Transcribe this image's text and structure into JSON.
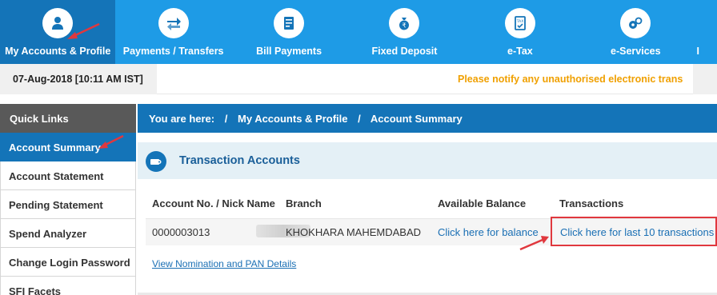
{
  "nav": {
    "items": [
      {
        "label": "My Accounts & Profile",
        "icon": "user-icon"
      },
      {
        "label": "Payments / Transfers",
        "icon": "transfer-icon"
      },
      {
        "label": "Bill Payments",
        "icon": "bill-icon"
      },
      {
        "label": "Fixed Deposit",
        "icon": "money-bag-icon"
      },
      {
        "label": "e-Tax",
        "icon": "tax-document-icon"
      },
      {
        "label": "e-Services",
        "icon": "services-icon"
      },
      {
        "label": "I",
        "icon": ""
      }
    ]
  },
  "datebar": {
    "datetime": "07-Aug-2018 [10:11 AM IST]",
    "alert": "Please notify any unauthorised electronic trans"
  },
  "sidebar": {
    "title": "Quick Links",
    "items": [
      {
        "label": "Account Summary"
      },
      {
        "label": "Account Statement"
      },
      {
        "label": "Pending Statement"
      },
      {
        "label": "Spend Analyzer"
      },
      {
        "label": "Change Login Password"
      },
      {
        "label": "SFI Facets"
      }
    ]
  },
  "breadcrumb": {
    "prefix": "You are here:",
    "sep": "/",
    "items": [
      "My Accounts & Profile",
      "Account Summary"
    ]
  },
  "section": {
    "title": "Transaction Accounts"
  },
  "table": {
    "headers": [
      "Account No. / Nick Name",
      "Branch",
      "Available Balance",
      "Transactions"
    ],
    "row": {
      "account": "0000003013",
      "branch": "KHOKHARA MAHEMDABAD",
      "balance_link": "Click here for balance",
      "transactions_link": "Click here for last 10 transactions"
    }
  },
  "nomination_link": "View Nomination and PAN Details",
  "colors": {
    "nav_blue": "#1e9be6",
    "active_blue": "#1474b8",
    "alert_orange": "#f0a000",
    "annotation_red": "#e0383e"
  }
}
